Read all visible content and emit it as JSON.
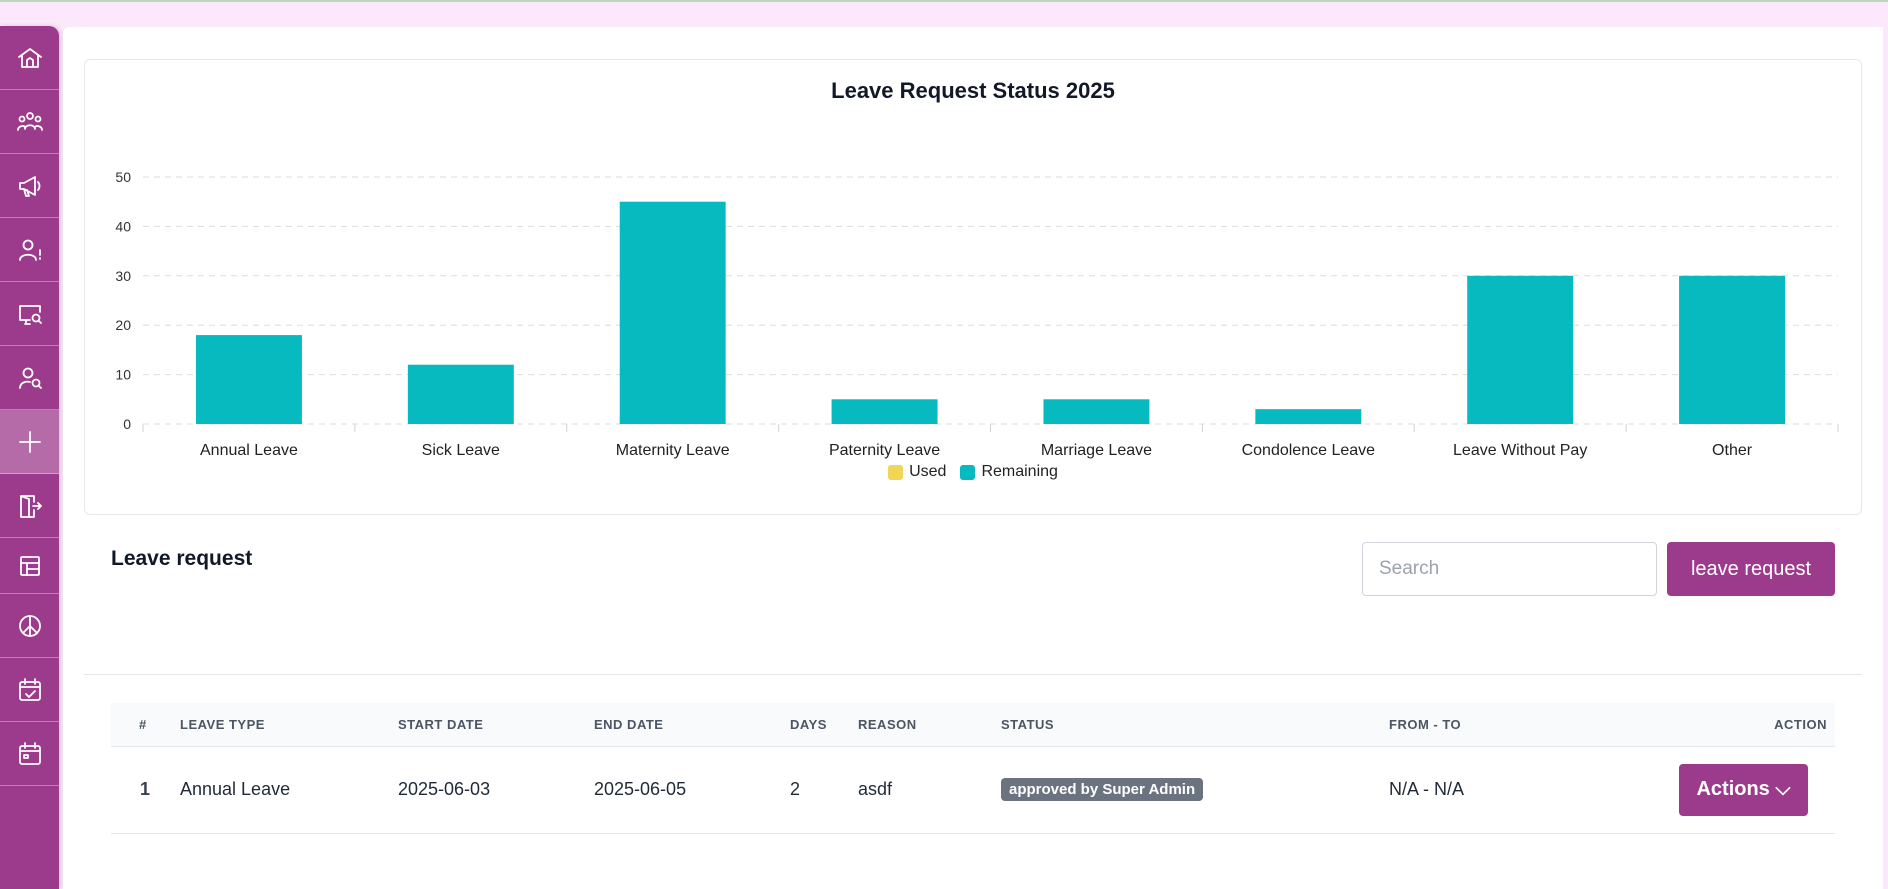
{
  "sidebar": {
    "items": [
      {
        "icon": "home-icon"
      },
      {
        "icon": "users-icon"
      },
      {
        "icon": "megaphone-icon"
      },
      {
        "icon": "user-alert-icon"
      },
      {
        "icon": "monitor-search-icon"
      },
      {
        "icon": "user-search-icon"
      },
      {
        "icon": "plus-icon"
      },
      {
        "icon": "door-exit-icon"
      },
      {
        "icon": "table-icon"
      },
      {
        "icon": "peace-icon"
      },
      {
        "icon": "calendar-check-icon"
      },
      {
        "icon": "calendar-icon"
      }
    ],
    "color": "#9c3b8c"
  },
  "chart_data": {
    "type": "bar",
    "title": "Leave Request Status 2025",
    "categories": [
      "Annual Leave",
      "Sick Leave",
      "Maternity Leave",
      "Paternity Leave",
      "Marriage Leave",
      "Condolence Leave",
      "Leave Without Pay",
      "Other"
    ],
    "series": [
      {
        "name": "Used",
        "values": [
          0,
          0,
          0,
          0,
          0,
          0,
          0,
          0
        ],
        "color": "#f0d654"
      },
      {
        "name": "Remaining",
        "values": [
          18,
          12,
          45,
          5,
          5,
          3,
          30,
          30
        ],
        "color": "#06babf"
      }
    ],
    "ylim": [
      0,
      50
    ],
    "yticks": [
      "0",
      "10",
      "20",
      "30",
      "40",
      "50"
    ],
    "grid": true,
    "legend_position": "bottom"
  },
  "leave_section": {
    "title": "Leave request",
    "search_placeholder": "Search",
    "button_label": "leave request"
  },
  "table": {
    "headers": {
      "index": "#",
      "leave_type": "LEAVE TYPE",
      "start_date": "START DATE",
      "end_date": "END DATE",
      "days": "DAYS",
      "reason": "REASON",
      "status": "STATUS",
      "from_to": "FROM - TO",
      "action": "ACTION"
    },
    "rows": [
      {
        "index": "1",
        "leave_type": "Annual Leave",
        "start_date": "2025-06-03",
        "end_date": "2025-06-05",
        "days": "2",
        "reason": "asdf",
        "status": "approved by Super Admin",
        "from_to": "N/A - N/A",
        "action_label": "Actions ⌵"
      }
    ]
  }
}
